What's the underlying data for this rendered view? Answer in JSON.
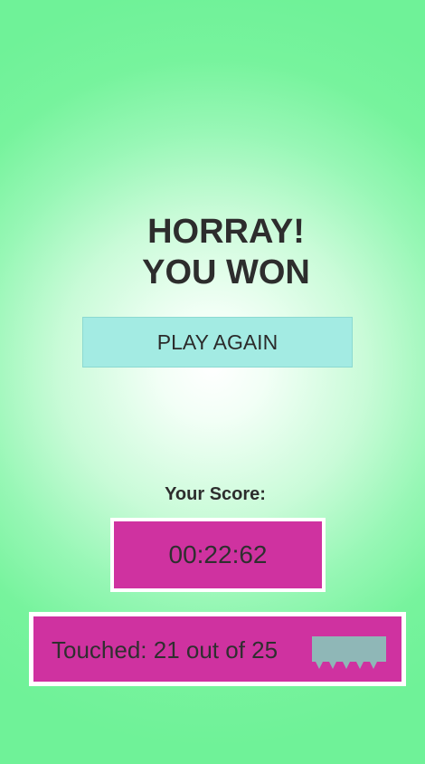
{
  "header": {
    "title_line1": "HORRAY!",
    "title_line2": "YOU WON"
  },
  "actions": {
    "play_again_label": "PLAY AGAIN"
  },
  "score": {
    "label": "Your Score:",
    "time": "00:22:62",
    "touched_text": "Touched: 21 out of 25",
    "touched": 21,
    "total": 25
  },
  "icons": {
    "touched_icon": "spike-block-icon"
  },
  "colors": {
    "background": "#6ff298",
    "button": "#a3ebe3",
    "score_box": "#cf32a0",
    "icon": "#8fb7b7"
  }
}
